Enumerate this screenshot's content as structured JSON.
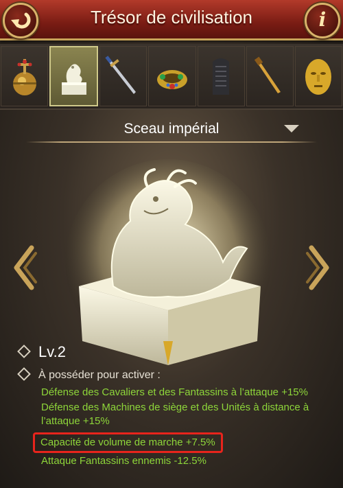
{
  "header": {
    "title": "Trésor de civilisation",
    "back_icon": "back-arrow-icon",
    "info_icon": "info-icon",
    "info_label": "i"
  },
  "treasure_slots": [
    {
      "name": "globus-cruciger",
      "selected": false
    },
    {
      "name": "imperial-seal",
      "selected": true
    },
    {
      "name": "sword",
      "selected": false
    },
    {
      "name": "jeweled-crown",
      "selected": false
    },
    {
      "name": "stone-stele",
      "selected": false
    },
    {
      "name": "golden-dagger",
      "selected": false
    },
    {
      "name": "golden-mask",
      "selected": false
    }
  ],
  "selector": {
    "current": "Sceau impérial"
  },
  "stats": {
    "level": "Lv.2",
    "requirement": "À posséder pour activer :",
    "bonuses": [
      "Défense des Cavaliers et des Fantassins à l’attaque +15%",
      "Défense des Machines de siège et des Unités à distance à l’attaque +15%",
      "Capacité de volume de marche +7.5%",
      "Attaque Fantassins ennemis -12.5%"
    ],
    "highlighted_index": 2
  },
  "colors": {
    "header_red": "#9a2a1e",
    "gold_border": "#c9a45a",
    "bonus_green": "#8ed63a",
    "highlight_red": "#e8241c"
  }
}
